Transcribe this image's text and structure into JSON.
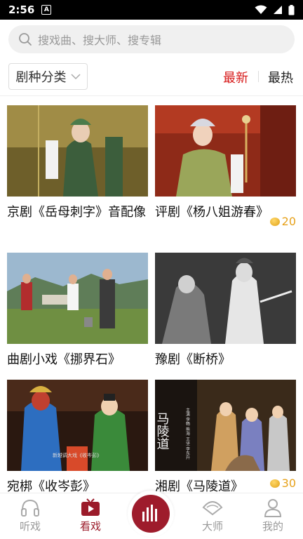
{
  "status_bar": {
    "time": "2:56",
    "app_icon_letter": "A"
  },
  "search": {
    "placeholder": "搜戏曲、搜大师、搜专辑"
  },
  "filter": {
    "label": "剧种分类"
  },
  "sort": {
    "latest": "最新",
    "hot": "最热",
    "active": "latest"
  },
  "colors": {
    "accent": "#d71a1a",
    "brand": "#9e1c2c",
    "coin": "#e6a11a"
  },
  "cards": [
    {
      "title": "京剧《岳母刺字》音配像",
      "coins": ""
    },
    {
      "title": "评剧《杨八姐游春》",
      "coins": "20"
    },
    {
      "title": "曲剧小戏《挪界石》",
      "coins": ""
    },
    {
      "title": "豫剧《断桥》",
      "coins": ""
    },
    {
      "title": "宛梆《收岑彭》",
      "coins": ""
    },
    {
      "title": "湘剧《马陵道》",
      "coins": "30"
    }
  ],
  "thumb_texts": {
    "card5_caption": "新越调大戏《收岑彭》",
    "card6_vertical": "马陵道",
    "card6_credits": "主演 李畅 熊海 王坚 李东升"
  },
  "tabs": [
    {
      "label": "听戏",
      "icon": "headphones-icon"
    },
    {
      "label": "看戏",
      "icon": "tv-play-icon"
    },
    {
      "label": "",
      "icon": "audio-bars-icon"
    },
    {
      "label": "大师",
      "icon": "fan-icon"
    },
    {
      "label": "我的",
      "icon": "user-icon"
    }
  ]
}
